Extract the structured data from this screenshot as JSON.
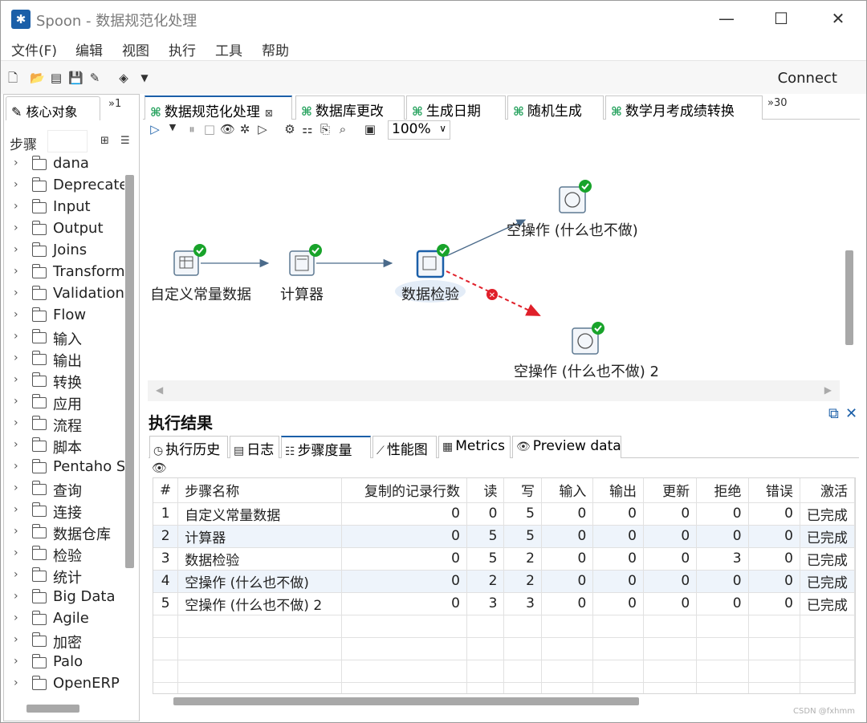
{
  "window": {
    "title": "Spoon - 数据规范化处理",
    "minimize_icon": "minimize-icon",
    "maximize_icon": "maximize-icon",
    "close_icon": "close-icon"
  },
  "menu": [
    "文件(F)",
    "编辑",
    "视图",
    "执行",
    "工具",
    "帮助"
  ],
  "toolbar": {
    "connect_label": "Connect"
  },
  "left_panel": {
    "tab_label": "核心对象",
    "tab_more": "»1",
    "steps_label": "步骤",
    "search_value": "",
    "tree_items": [
      "dana",
      "Deprecated",
      "Input",
      "Output",
      "Joins",
      "Transform",
      "Validation",
      "Flow",
      "输入",
      "输出",
      "转换",
      "应用",
      "流程",
      "脚本",
      "Pentaho Server",
      "查询",
      "连接",
      "数据仓库",
      "检验",
      "统计",
      "Big Data",
      "Agile",
      "加密",
      "Palo",
      "OpenERP"
    ]
  },
  "editor_tabs": {
    "tabs": [
      "数据规范化处理",
      "数据库更改",
      "生成日期",
      "随机生成",
      "数学月考成绩转换"
    ],
    "more": "»30"
  },
  "canvas_toolbar": {
    "zoom": "100%"
  },
  "canvas": {
    "nodes": [
      {
        "label": "自定义常量数据",
        "icon": "constant-data-icon",
        "status": "ok"
      },
      {
        "label": "计算器",
        "icon": "calculator-icon",
        "status": "ok"
      },
      {
        "label": "数据检验",
        "icon": "data-validator-icon",
        "status": "ok"
      },
      {
        "label": "空操作 (什么也不做)",
        "icon": "dummy-icon",
        "status": "ok"
      },
      {
        "label": "空操作 (什么也不做) 2",
        "icon": "dummy-icon",
        "status": "ok"
      }
    ],
    "colors": {
      "hop": "#4a6a8a",
      "error_hop": "#e0202a",
      "ok_badge": "#18a32a"
    }
  },
  "results": {
    "title": "执行结果",
    "tabs": [
      "执行历史",
      "日志",
      "步骤度量",
      "性能图",
      "Metrics",
      "Preview data"
    ],
    "active_tab": "步骤度量",
    "columns": [
      "#",
      "步骤名称",
      "复制的记录行数",
      "读",
      "写",
      "输入",
      "输出",
      "更新",
      "拒绝",
      "错误",
      "激活"
    ],
    "rows": [
      [
        "1",
        "自定义常量数据",
        "0",
        "0",
        "5",
        "0",
        "0",
        "0",
        "0",
        "0",
        "已完成"
      ],
      [
        "2",
        "计算器",
        "0",
        "5",
        "5",
        "0",
        "0",
        "0",
        "0",
        "0",
        "已完成"
      ],
      [
        "3",
        "数据检验",
        "0",
        "5",
        "2",
        "0",
        "0",
        "0",
        "3",
        "0",
        "已完成"
      ],
      [
        "4",
        "空操作 (什么也不做)",
        "0",
        "2",
        "2",
        "0",
        "0",
        "0",
        "0",
        "0",
        "已完成"
      ],
      [
        "5",
        "空操作 (什么也不做) 2",
        "0",
        "3",
        "3",
        "0",
        "0",
        "0",
        "0",
        "0",
        "已完成"
      ]
    ]
  },
  "watermark": "CSDN @fxhmm"
}
